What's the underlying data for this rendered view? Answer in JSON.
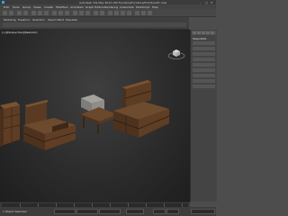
{
  "window": {
    "title": "Autodesk 3ds Max 2013 x64    Furniture/Furniture/Furniture01.max",
    "min_glyph": "–",
    "max_glyph": "□",
    "close_glyph": "✕"
  },
  "menu": [
    "Edit",
    "Tools",
    "Group",
    "Views",
    "Create",
    "Modifiers",
    "Animation",
    "Graph Editors",
    "Rendering",
    "Customize",
    "MAXScript",
    "Help"
  ],
  "ribbon": {
    "tabs": [
      "Modeling",
      "Freeform",
      "Selection",
      "Object Paint",
      "Populate"
    ]
  },
  "viewport": {
    "label": "[+][Perspective][Realistic]"
  },
  "command_panel": {
    "title": "Teapot001"
  },
  "status": {
    "text": "1 Object Selected"
  },
  "colors": {
    "viewport_bg": "#2c2c2c",
    "panel_bg": "#444444",
    "wood": "#5a3a22",
    "stone": "#8a8a86"
  }
}
